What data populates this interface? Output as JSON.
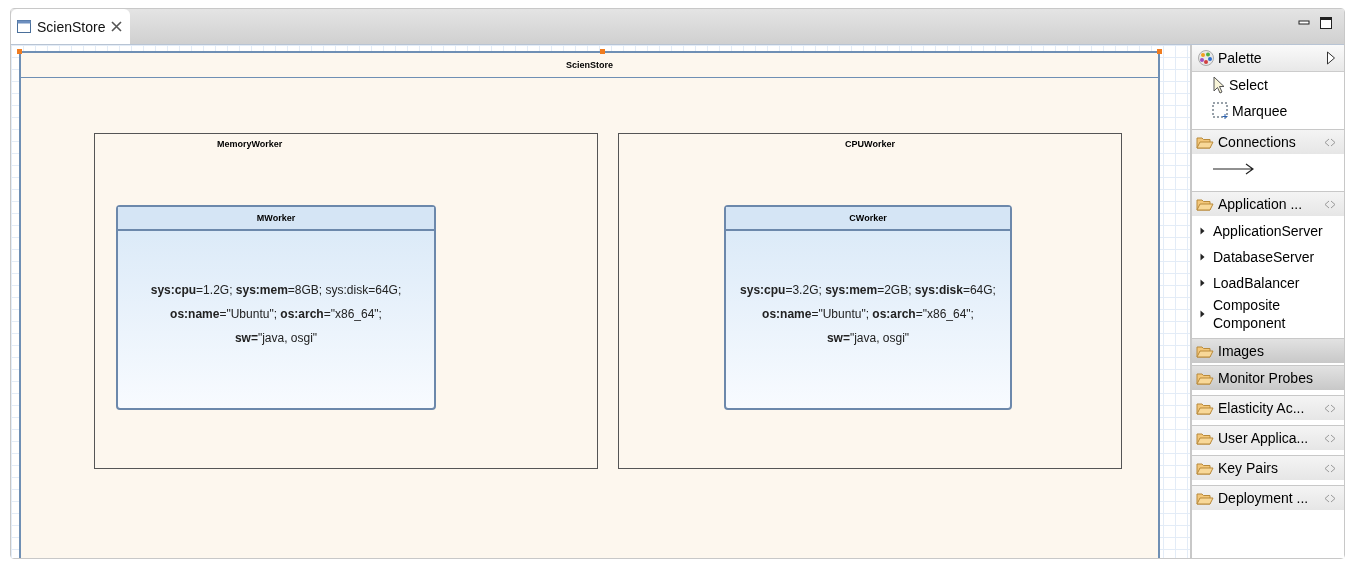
{
  "editor_tab": {
    "title": "ScienStore",
    "selected": true
  },
  "diagram": {
    "title": "ScienStore",
    "containers": [
      {
        "title": "MemoryWorker",
        "node": {
          "title": "MWorker",
          "properties": [
            "**sys:cpu**=1.2G; **sys:mem**=8GB; sys:disk=64G;",
            "**os:name**=\"Ubuntu\"; **os:arch**=\"x86_64\";",
            "**sw=**\"java, osgi\""
          ]
        }
      },
      {
        "title": "CPUWorker",
        "node": {
          "title": "CWorker",
          "properties": [
            "**sys:cpu**=3.2G; **sys:mem**=2GB; **sys:disk**=64G;",
            "**os:name**=\"Ubuntu\"; **os:arch**=\"x86_64\";",
            "**sw=**\"java, osgi\""
          ]
        }
      }
    ]
  },
  "palette": {
    "title": "Palette",
    "tools": [
      {
        "kind": "pointer",
        "label": "Select"
      },
      {
        "kind": "marquee",
        "label": "Marquee"
      }
    ],
    "drawers": [
      {
        "label": "Connections",
        "expanded": true,
        "highlighted": false,
        "pin_icon": true,
        "entries": [
          {
            "kind": "connection"
          }
        ]
      },
      {
        "label": "Application ...",
        "expanded": true,
        "highlighted": false,
        "pin_icon": true,
        "entries": [
          {
            "kind": "item",
            "label": "ApplicationServer"
          },
          {
            "kind": "item",
            "label": "DatabaseServer"
          },
          {
            "kind": "item",
            "label": "LoadBalancer"
          },
          {
            "kind": "item",
            "label": "Composite Component"
          }
        ]
      },
      {
        "label": "Images",
        "expanded": false,
        "highlighted": true,
        "pin_icon": false
      },
      {
        "label": "Monitor Probes",
        "expanded": false,
        "highlighted": true,
        "pin_icon": false
      },
      {
        "label": "Elasticity Ac...",
        "expanded": false,
        "highlighted": false,
        "pin_icon": true
      },
      {
        "label": "User Applica...",
        "expanded": false,
        "highlighted": false,
        "pin_icon": true
      },
      {
        "label": "Key Pairs",
        "expanded": false,
        "highlighted": false,
        "pin_icon": true
      },
      {
        "label": "Deployment ...",
        "expanded": false,
        "highlighted": false,
        "pin_icon": true
      }
    ]
  }
}
